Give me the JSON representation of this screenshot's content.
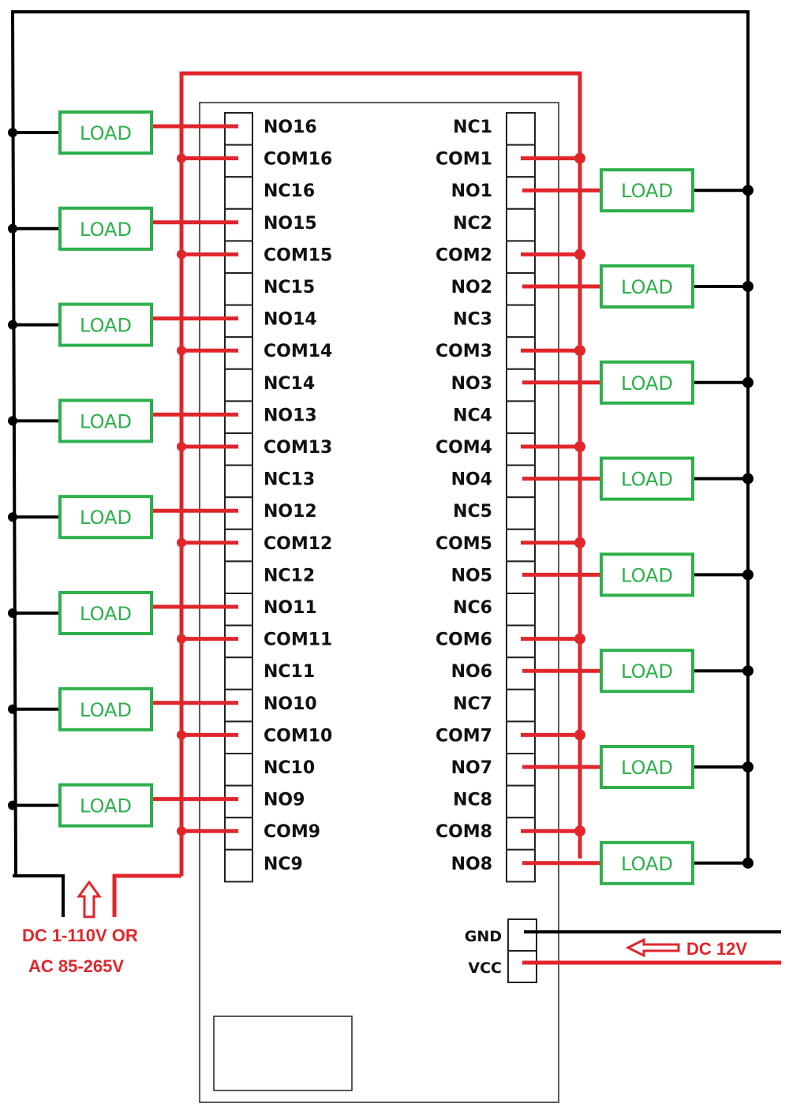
{
  "colors": {
    "live": "#e0262c",
    "neutral": "#000000",
    "load": "#2db04b",
    "board": "#222222"
  },
  "left_terminals": [
    "NO16",
    "COM16",
    "NC16",
    "NO15",
    "COM15",
    "NC15",
    "NO14",
    "COM14",
    "NC14",
    "NO13",
    "COM13",
    "NC13",
    "NO12",
    "COM12",
    "NC12",
    "NO11",
    "COM11",
    "NC11",
    "NO10",
    "COM10",
    "NC10",
    "NO9",
    "COM9",
    "NC9"
  ],
  "right_terminals": [
    "NC1",
    "COM1",
    "NO1",
    "NC2",
    "COM2",
    "NO2",
    "NC3",
    "COM3",
    "NO3",
    "NC4",
    "COM4",
    "NO4",
    "NC5",
    "COM5",
    "NO5",
    "NC6",
    "COM6",
    "NO6",
    "NC7",
    "COM7",
    "NO7",
    "NC8",
    "COM8",
    "NO8"
  ],
  "load_label": "LOAD",
  "power_input": {
    "line1": "DC 1-110V OR",
    "line2": "AC 85-265V",
    "icon": "arrow-up-icon"
  },
  "control_power": {
    "gnd": "GND",
    "vcc": "VCC",
    "label": "DC 12V",
    "icon": "arrow-left-icon"
  }
}
